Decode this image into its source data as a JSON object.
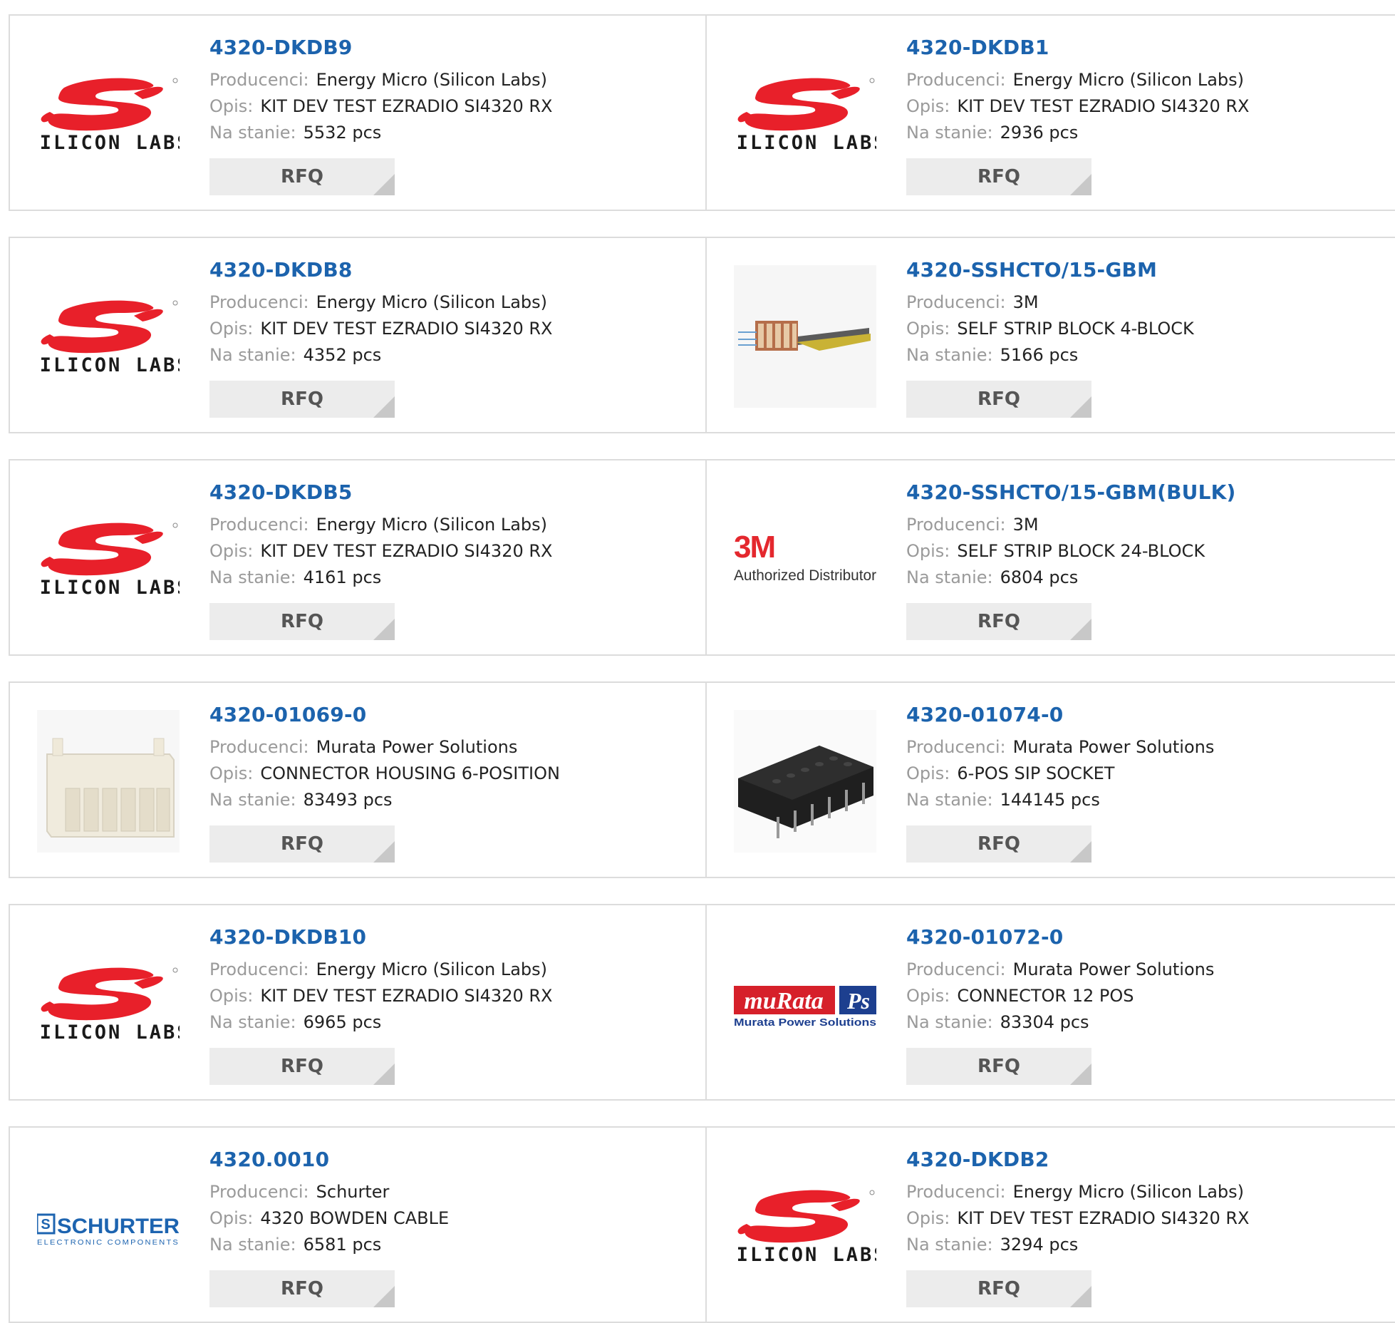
{
  "labels": {
    "manufacturer": "Producenci:",
    "description": "Opis:",
    "stock": "Na stanie:",
    "rfq": "RFQ"
  },
  "logos": {
    "silicon_labs": "SILICON LABS",
    "threem_mark": "3M",
    "threem_sub": "Authorized Distributor",
    "murata_mark": "muRata",
    "murata_ps": "Ps",
    "murata_sub": "Murata Power Solutions",
    "schurter_mark": "SCHURTER",
    "schurter_sub": "ELECTRONIC COMPONENTS"
  },
  "colors": {
    "link": "#1c63ad",
    "silicon_red": "#e8202a",
    "murata_red": "#d6202a",
    "murata_blue": "#1d3f8f",
    "schurter_blue": "#1d64b0"
  },
  "products": [
    {
      "part": "4320-DKDB9",
      "manufacturer": "Energy Micro (Silicon Labs)",
      "description": "KIT DEV TEST EZRADIO SI4320 RX",
      "stock": "5532 pcs",
      "image": "silicon-labs-logo"
    },
    {
      "part": "4320-DKDB1",
      "manufacturer": "Energy Micro (Silicon Labs)",
      "description": "KIT DEV TEST EZRADIO SI4320 RX",
      "stock": "2936 pcs",
      "image": "silicon-labs-logo"
    },
    {
      "part": "4320-DKDB8",
      "manufacturer": "Energy Micro (Silicon Labs)",
      "description": "KIT DEV TEST EZRADIO SI4320 RX",
      "stock": "4352 pcs",
      "image": "silicon-labs-logo"
    },
    {
      "part": "4320-SSHCTO/15-GBM",
      "manufacturer": "3M",
      "description": "SELF STRIP BLOCK 4-BLOCK",
      "stock": "5166 pcs",
      "image": "strip-block-photo"
    },
    {
      "part": "4320-DKDB5",
      "manufacturer": "Energy Micro (Silicon Labs)",
      "description": "KIT DEV TEST EZRADIO SI4320 RX",
      "stock": "4161 pcs",
      "image": "silicon-labs-logo"
    },
    {
      "part": "4320-SSHCTO/15-GBM(BULK)",
      "manufacturer": "3M",
      "description": "SELF STRIP BLOCK 24-BLOCK",
      "stock": "6804 pcs",
      "image": "3m-logo"
    },
    {
      "part": "4320-01069-0",
      "manufacturer": "Murata Power Solutions",
      "description": "CONNECTOR HOUSING 6-POSITION",
      "stock": "83493 pcs",
      "image": "connector-housing-photo"
    },
    {
      "part": "4320-01074-0",
      "manufacturer": "Murata Power Solutions",
      "description": "6-POS SIP SOCKET",
      "stock": "144145 pcs",
      "image": "sip-socket-photo"
    },
    {
      "part": "4320-DKDB10",
      "manufacturer": "Energy Micro (Silicon Labs)",
      "description": "KIT DEV TEST EZRADIO SI4320 RX",
      "stock": "6965 pcs",
      "image": "silicon-labs-logo"
    },
    {
      "part": "4320-01072-0",
      "manufacturer": "Murata Power Solutions",
      "description": "CONNECTOR 12 POS",
      "stock": "83304 pcs",
      "image": "murata-logo"
    },
    {
      "part": "4320.0010",
      "manufacturer": "Schurter",
      "description": "4320 BOWDEN CABLE",
      "stock": "6581 pcs",
      "image": "schurter-logo"
    },
    {
      "part": "4320-DKDB2",
      "manufacturer": "Energy Micro (Silicon Labs)",
      "description": "KIT DEV TEST EZRADIO SI4320 RX",
      "stock": "3294 pcs",
      "image": "silicon-labs-logo"
    }
  ]
}
